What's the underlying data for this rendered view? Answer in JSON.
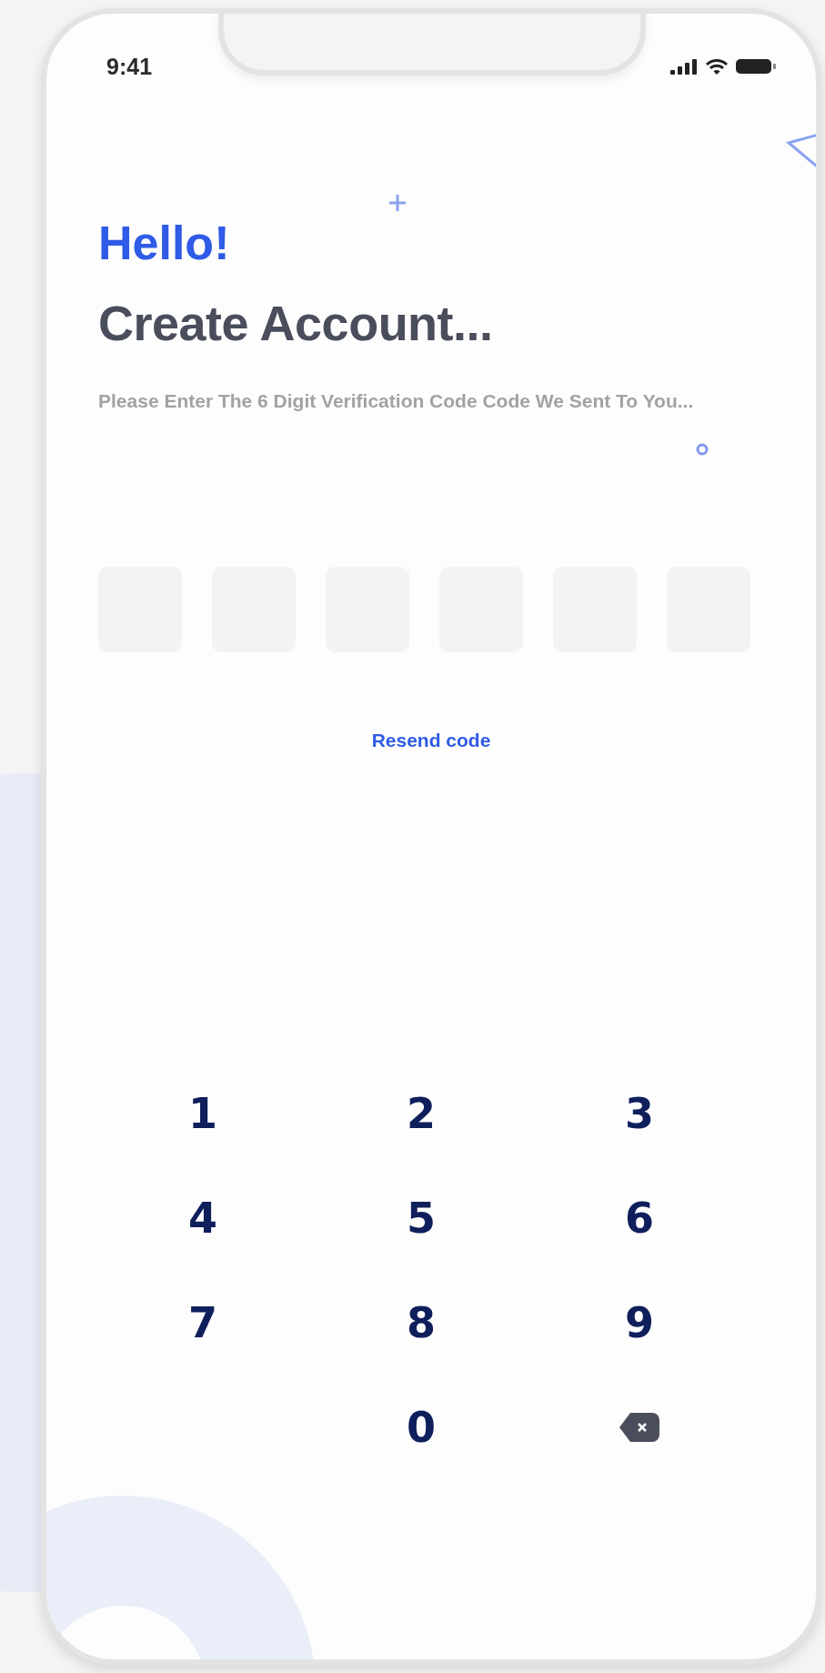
{
  "status_bar": {
    "time": "9:41"
  },
  "greeting": "Hello!",
  "title": "Create Account...",
  "instruction": "Please Enter The 6 Digit Verification Code Code We Sent To You...",
  "code_fields": [
    {
      "selected": false
    },
    {
      "selected": false
    },
    {
      "selected": false
    },
    {
      "selected": false
    },
    {
      "selected": false
    },
    {
      "selected": false
    }
  ],
  "resend_link": "Resend code",
  "keypad": [
    {
      "kind": "digit",
      "label": "1"
    },
    {
      "kind": "digit",
      "label": "2"
    },
    {
      "kind": "digit",
      "label": "3"
    },
    {
      "kind": "digit",
      "label": "4"
    },
    {
      "kind": "digit",
      "label": "5"
    },
    {
      "kind": "digit",
      "label": "6"
    },
    {
      "kind": "digit",
      "label": "7"
    },
    {
      "kind": "digit",
      "label": "8"
    },
    {
      "kind": "digit",
      "label": "9"
    },
    {
      "kind": "blank"
    },
    {
      "kind": "digit",
      "label": "0"
    },
    {
      "kind": "backspace"
    }
  ]
}
